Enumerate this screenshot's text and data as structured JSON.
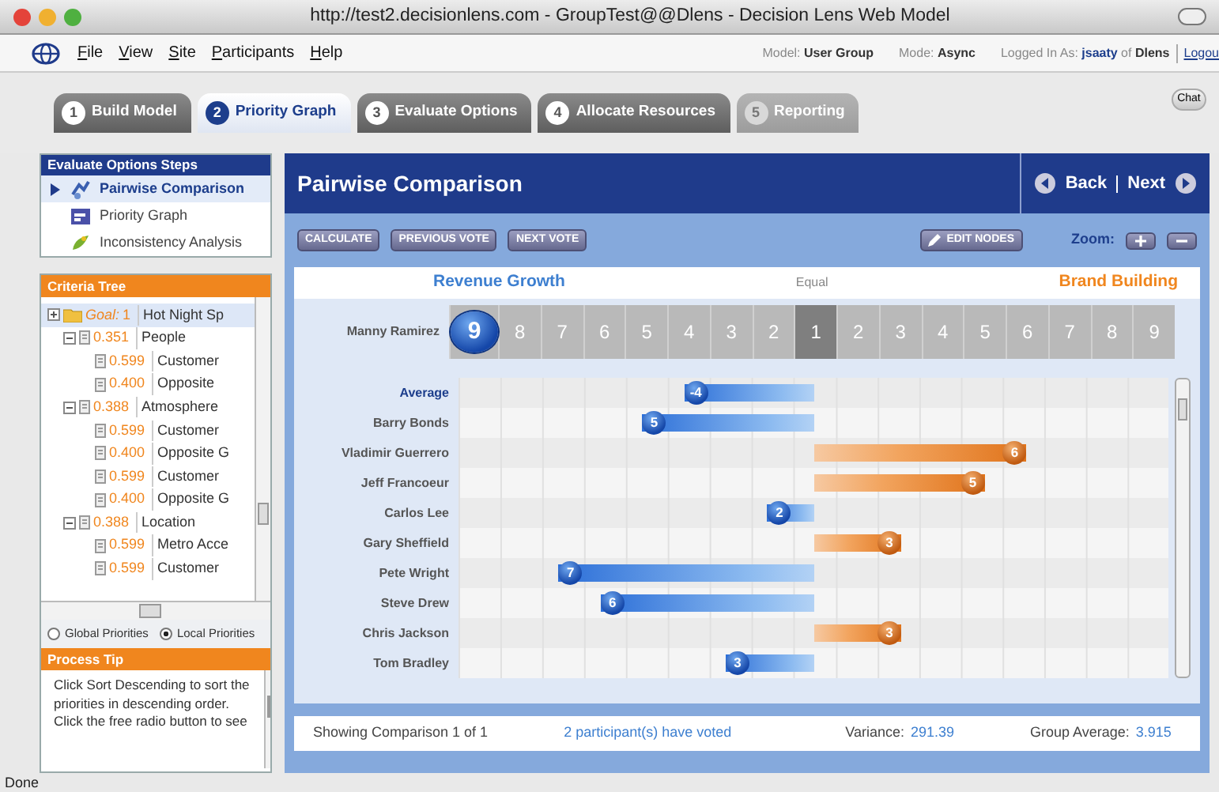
{
  "window": {
    "title": "http://test2.decisionlens.com - GroupTest@@Dlens - Decision Lens Web Model"
  },
  "menu": [
    "File",
    "View",
    "Site",
    "Participants",
    "Help"
  ],
  "session": [
    {
      "label": "Model:",
      "value": "User Group"
    },
    {
      "label": "Mode:",
      "value": "Async"
    }
  ],
  "login": "Logged In As: **jsaaty** of **Dlens**",
  "logout": "Logou",
  "tabs": [
    {
      "number": "1",
      "label": "Build Model",
      "selected": false,
      "disabled": false
    },
    {
      "number": "2",
      "label": "Priority Graph",
      "selected": true,
      "disabled": false
    },
    {
      "number": "3",
      "label": "Evaluate Options",
      "selected": false,
      "disabled": false
    },
    {
      "number": "4",
      "label": "Allocate Resources",
      "selected": false,
      "disabled": false
    },
    {
      "number": "5",
      "label": "Reporting",
      "selected": false,
      "disabled": true
    }
  ],
  "chat": "Chat",
  "steps": {
    "title": "Evaluate Options Steps",
    "items": [
      {
        "kind": "pairwise",
        "label": "Pairwise Comparison",
        "selected": true
      },
      {
        "kind": "graph",
        "label": "Priority Graph",
        "selected": false
      },
      {
        "kind": "analysis",
        "label": "Inconsistency Analysis",
        "selected": false
      }
    ]
  },
  "criteria_tree": {
    "title": "Criteria Tree",
    "nodes": [
      {
        "kind": "goal",
        "prefix": "Goal:",
        "weight": "1",
        "label": "Hot Night Sp",
        "expanded": false,
        "selected": true,
        "children": [
          {
            "weight": "0.351",
            "label": "People",
            "expanded": true,
            "selected": false,
            "children": [
              {
                "weight": "0.599",
                "label": "Customer",
                "selected": false
              },
              {
                "weight": "0.400",
                "label": "Opposite",
                "selected": false
              }
            ]
          },
          {
            "weight": "0.388",
            "label": "Atmosphere",
            "expanded": true,
            "selected": false,
            "children": [
              {
                "weight": "0.599",
                "label": "Customer",
                "selected": false
              },
              {
                "weight": "0.400",
                "label": "Opposite G",
                "selected": false
              },
              {
                "weight": "0.599",
                "label": "Customer",
                "selected": false
              },
              {
                "weight": "0.400",
                "label": "Opposite G",
                "selected": false
              }
            ]
          },
          {
            "weight": "0.388",
            "label": "Location",
            "expanded": true,
            "selected": false,
            "children": [
              {
                "weight": "0.599",
                "label": "Metro Acce",
                "selected": false
              },
              {
                "weight": "0.599",
                "label": "Customer",
                "selected": false
              }
            ]
          }
        ]
      }
    ]
  },
  "priority_mode": [
    {
      "label": "Global Priorities",
      "selected": false
    },
    {
      "label": "Local Priorities",
      "selected": true
    }
  ],
  "process_tip": {
    "title": "Process Tip",
    "text": "Click Sort Descending to sort the priorities in descending order. Click the free radio button to see"
  },
  "comparison": {
    "title": "Pairwise Comparison",
    "back": "Back",
    "next": "Next",
    "toolbar": [
      "CALCULATE",
      "PREVIOUS VOTE",
      "NEXT VOTE"
    ],
    "edit_nodes": "EDIT NODES",
    "zoom_label": "Zoom:"
  },
  "left_criterion": "Revenue Growth",
  "equal_label": "Equal",
  "right_criterion": "Brand Building",
  "participant": {
    "name": "Manny Ramirez",
    "scale": [
      {
        "label": "9",
        "kind": "scale",
        "selected": true
      },
      {
        "label": "8",
        "kind": "scale",
        "selected": false
      },
      {
        "label": "7",
        "kind": "scale",
        "selected": false
      },
      {
        "label": "6",
        "kind": "scale",
        "selected": false
      },
      {
        "label": "5",
        "kind": "scale",
        "selected": false
      },
      {
        "label": "4",
        "kind": "scale",
        "selected": false
      },
      {
        "label": "3",
        "kind": "scale",
        "selected": false
      },
      {
        "label": "2",
        "kind": "scale",
        "selected": false
      },
      {
        "label": "1",
        "kind": "equal",
        "selected": false
      },
      {
        "label": "2",
        "kind": "scale",
        "selected": false
      },
      {
        "label": "3",
        "kind": "scale",
        "selected": false
      },
      {
        "label": "4",
        "kind": "scale",
        "selected": false
      },
      {
        "label": "5",
        "kind": "scale",
        "selected": false
      },
      {
        "label": "6",
        "kind": "scale",
        "selected": false
      },
      {
        "label": "7",
        "kind": "scale",
        "selected": false
      },
      {
        "label": "8",
        "kind": "scale",
        "selected": false
      },
      {
        "label": "9",
        "kind": "scale",
        "selected": false
      }
    ]
  },
  "average": {
    "name": "Average",
    "kind": "left",
    "value": "-4"
  },
  "votes": [
    {
      "name": "Barry Bonds",
      "kind": "left",
      "value": "5"
    },
    {
      "name": "Vladimir Guerrero",
      "kind": "right",
      "value": "6"
    },
    {
      "name": "Jeff Francoeur",
      "kind": "right",
      "value": "5"
    },
    {
      "name": "Carlos Lee",
      "kind": "left",
      "value": "2"
    },
    {
      "name": "Gary Sheffield",
      "kind": "right",
      "value": "3"
    },
    {
      "name": "Pete Wright",
      "kind": "left",
      "value": "7"
    },
    {
      "name": "Steve Drew",
      "kind": "left",
      "value": "6"
    },
    {
      "name": "Chris Jackson",
      "kind": "right",
      "value": "3"
    },
    {
      "name": "Tom Bradley",
      "kind": "left",
      "value": "3"
    }
  ],
  "footer": {
    "showing": "Showing Comparison 1 of 1",
    "voted": "2 participant(s) have voted",
    "variance_label": "Variance:",
    "variance": "291.39",
    "average_label": "Group Average:",
    "average": "3.915"
  },
  "status_bar": "Done"
}
